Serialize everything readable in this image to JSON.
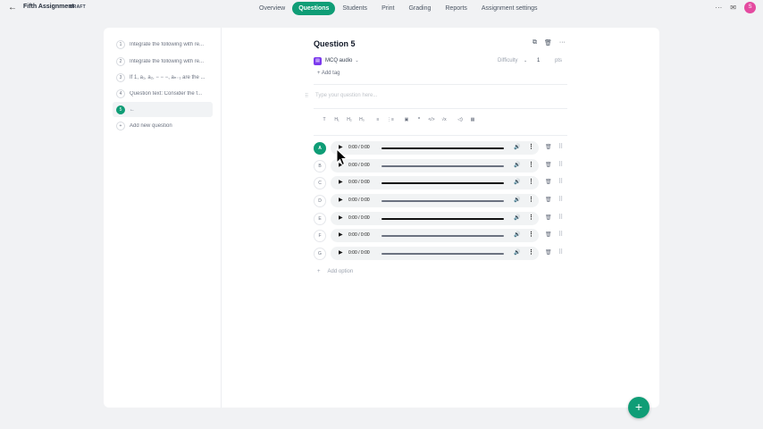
{
  "header": {
    "back_icon": "arrow-left-icon",
    "assignment_title": "Fifth Assignment",
    "status_badge": "DRAFT",
    "tabs": [
      {
        "label": "Overview",
        "active": false
      },
      {
        "label": "Questions",
        "active": true
      },
      {
        "label": "Students",
        "active": false
      },
      {
        "label": "Print",
        "active": false
      },
      {
        "label": "Grading",
        "active": false
      },
      {
        "label": "Reports",
        "active": false
      },
      {
        "label": "Assignment settings",
        "active": false
      }
    ],
    "avatar_initial": "S",
    "accent_color": "#0f9d76"
  },
  "sidebar": {
    "items": [
      {
        "num": "1",
        "text": "Integrate the following with re..."
      },
      {
        "num": "2",
        "text": "Integrate the following with re..."
      },
      {
        "num": "3",
        "text": "If 1, a₁, a₂, − − −, aₙ₋₁ are the ..."
      },
      {
        "num": "4",
        "text": "Question text: Consider the f..."
      },
      {
        "num": "5",
        "text": "←"
      }
    ],
    "add_label": "Add new question"
  },
  "question": {
    "title": "Question 5",
    "type_label": "MCQ audio",
    "difficulty_label": "Difficulty",
    "points_value": "1",
    "points_label": "pts",
    "add_tag_label": "+ Add tag",
    "input_placeholder": "Type your question here..."
  },
  "toolbar": [
    "T",
    "H₁",
    "H₂",
    "H₃",
    "≡",
    "⋮≡",
    "▣",
    "❞",
    "</>",
    "√x",
    "◁)",
    "▦"
  ],
  "options": [
    {
      "letter": "A",
      "selected": true,
      "time": "0:00 / 0:00"
    },
    {
      "letter": "B",
      "selected": false,
      "time": "0:00 / 0:00"
    },
    {
      "letter": "C",
      "selected": false,
      "time": "0:00 / 0:00"
    },
    {
      "letter": "D",
      "selected": false,
      "time": "0:00 / 0:00"
    },
    {
      "letter": "E",
      "selected": false,
      "time": "0:00 / 0:00"
    },
    {
      "letter": "F",
      "selected": false,
      "time": "0:00 / 0:00"
    },
    {
      "letter": "G",
      "selected": false,
      "time": "0:00 / 0:00"
    }
  ],
  "add_option_label": "Add option"
}
